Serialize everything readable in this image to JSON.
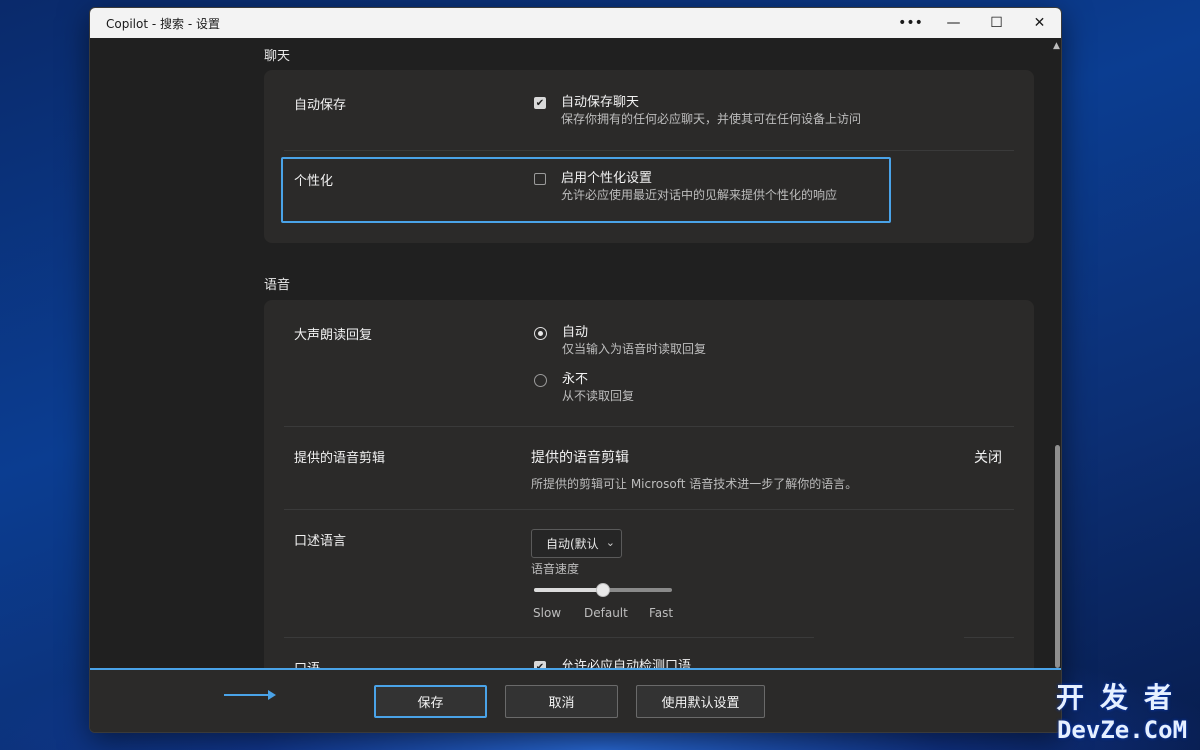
{
  "window": {
    "title": "Copilot - 搜索 - 设置",
    "controls": {
      "more": "•••",
      "minimize": "—",
      "maximize": "☐",
      "close": "✕"
    }
  },
  "chat_section": {
    "title": "聊天",
    "auto_save": {
      "label": "自动保存",
      "option_title": "自动保存聊天",
      "option_desc": "保存你拥有的任何必应聊天，并使其可在任何设备上访问",
      "checked": true
    },
    "personalization": {
      "label": "个性化",
      "option_title": "启用个性化设置",
      "option_desc": "允许必应使用最近对话中的见解来提供个性化的响应",
      "checked": false
    }
  },
  "voice_section": {
    "title": "语音",
    "read_aloud": {
      "label": "大声朗读回复",
      "options": [
        {
          "title": "自动",
          "desc": "仅当输入为语音时读取回复",
          "selected": true
        },
        {
          "title": "永不",
          "desc": "从不读取回复",
          "selected": false
        }
      ]
    },
    "voice_clips": {
      "label": "提供的语音剪辑",
      "heading": "提供的语音剪辑",
      "desc": "所提供的剪辑可让 Microsoft 语音技术进一步了解你的语言。",
      "toggle_text": "关闭"
    },
    "dictation_language": {
      "label": "口述语言",
      "select_value": "自动(默认",
      "speed_label": "语音速度",
      "speed_value": 0.5,
      "speed_ticks": [
        "Slow",
        "Default",
        "Fast"
      ]
    },
    "spoken_language": {
      "label": "口语",
      "option_title": "允许必应自动检测口语",
      "checked": true
    }
  },
  "footer": {
    "save": "保存",
    "cancel": "取消",
    "defaults": "使用默认设置"
  },
  "watermark": {
    "line1": "开发者",
    "line2": "DevZe.CoM"
  },
  "colors": {
    "accent": "#4aa3e8",
    "card": "#2b2a29",
    "background": "#202020"
  }
}
